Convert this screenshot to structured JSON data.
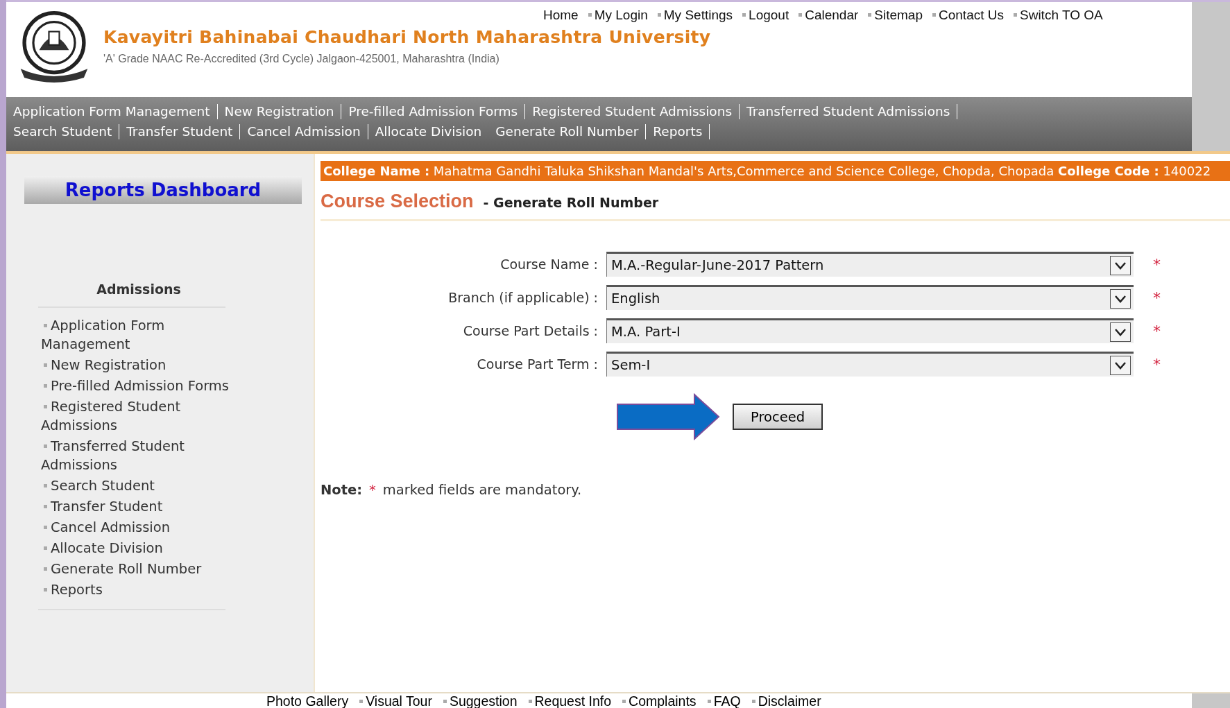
{
  "header": {
    "title": "Kavayitri Bahinabai Chaudhari North Maharashtra University",
    "subtitle": "'A' Grade NAAC Re-Accredited (3rd Cycle) Jalgaon-425001, Maharashtra (India)",
    "top_links": [
      {
        "label": "Home",
        "bullet": false
      },
      {
        "label": "My Login",
        "bullet": true
      },
      {
        "label": "My Settings",
        "bullet": true
      },
      {
        "label": "Logout",
        "bullet": true
      },
      {
        "label": "Calendar",
        "bullet": true
      },
      {
        "label": "Sitemap",
        "bullet": true
      },
      {
        "label": "Contact Us",
        "bullet": true
      },
      {
        "label": "Switch TO OA",
        "bullet": true
      }
    ]
  },
  "nav": {
    "links": [
      {
        "label": "Application Form Management",
        "separator": true
      },
      {
        "label": "New Registration",
        "separator": true
      },
      {
        "label": "Pre-filled Admission Forms",
        "separator": true
      },
      {
        "label": "Registered Student Admissions",
        "separator": true
      },
      {
        "label": "Transferred Student Admissions",
        "separator": true
      },
      {
        "label": "Search Student",
        "separator": true
      },
      {
        "label": "Transfer Student",
        "separator": true
      },
      {
        "label": "Cancel Admission",
        "separator": true
      },
      {
        "label": "Allocate Division",
        "separator": false
      },
      {
        "label": "Generate Roll Number",
        "separator": true
      },
      {
        "label": "Reports",
        "separator": true
      }
    ]
  },
  "sidebar": {
    "dashboard_button": "Reports Dashboard",
    "section_title": "Admissions",
    "items": [
      "Application Form Management",
      "New Registration",
      "Pre-filled Admission Forms",
      "Registered Student Admissions",
      "Transferred Student Admissions",
      "Search Student",
      "Transfer Student",
      "Cancel Admission",
      "Allocate Division",
      "Generate Roll Number",
      "Reports"
    ]
  },
  "college_banner": "**College Name :** Mahatma Gandhi Taluka Shikshan Mandal's Arts,Commerce and Science College, Chopda, Chopada **College Code :** 140022",
  "page_title": "Course Selection",
  "page_subtitle": "- Generate Roll Number",
  "form": {
    "fields": [
      {
        "label": "Course Name :",
        "value": "M.A.-Regular-June-2017 Pattern",
        "required": true
      },
      {
        "label": "Branch (if applicable) :",
        "value": "English",
        "required": true
      },
      {
        "label": "Course Part Details :",
        "value": "M.A. Part-I",
        "required": true
      },
      {
        "label": "Course Part Term :",
        "value": "Sem-I",
        "required": true
      }
    ],
    "required_mark": "*",
    "submit": "Proceed"
  },
  "note": {
    "label": "Note:",
    "mark": "*",
    "text": "marked fields are mandatory."
  },
  "footer_links": [
    {
      "label": "Photo Gallery",
      "bullet": false
    },
    {
      "label": "Visual Tour",
      "bullet": true
    },
    {
      "label": "Suggestion",
      "bullet": true
    },
    {
      "label": "Request Info",
      "bullet": true
    },
    {
      "label": "Complaints",
      "bullet": true
    },
    {
      "label": "FAQ",
      "bullet": true
    },
    {
      "label": "Disclaimer",
      "bullet": true
    }
  ]
}
